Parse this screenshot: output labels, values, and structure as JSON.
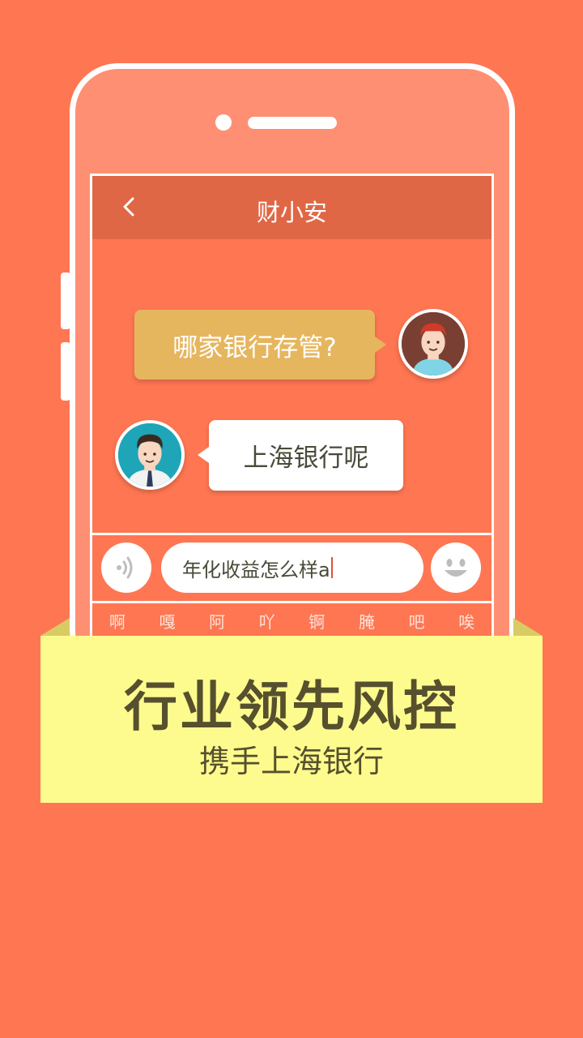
{
  "app": {
    "title": "财小安"
  },
  "chat": {
    "messages": [
      {
        "sender": "user",
        "text": "哪家银行存管?"
      },
      {
        "sender": "advisor",
        "text": "上海银行呢"
      }
    ]
  },
  "input": {
    "value": "年化收益怎么样a"
  },
  "keyboard": {
    "candidates": [
      "啊",
      "嘎",
      "阿",
      "吖",
      "锕",
      "腌",
      "吧",
      "唉"
    ]
  },
  "banner": {
    "headline": "行业领先风控",
    "subline": "携手上海银行"
  },
  "colors": {
    "background": "#FF7652",
    "topbar": "#E06746",
    "question_bubble": "#E6B65E",
    "banner": "#FEFB8E",
    "banner_text": "#56502E"
  },
  "icons": [
    "back-icon",
    "voice-icon",
    "emoji-icon"
  ]
}
